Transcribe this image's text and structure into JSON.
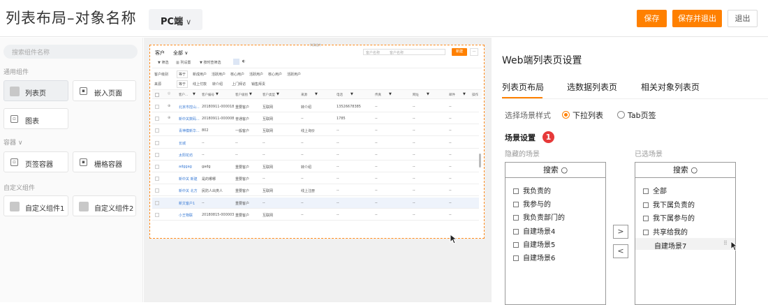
{
  "header": {
    "title": "列表布局–对象名称",
    "platform": "PC端",
    "save": "保存",
    "save_exit": "保存并退出",
    "exit": "退出"
  },
  "left": {
    "search_placeholder": "搜索组件名称",
    "sections": [
      {
        "title": "通用组件",
        "items": [
          "列表页",
          "嵌入页面",
          "图表"
        ]
      },
      {
        "title": "容器",
        "items": [
          "页签容器",
          "栅格容器"
        ]
      },
      {
        "title": "自定义组件",
        "items": [
          "自定义组件1",
          "自定义组件2"
        ]
      }
    ]
  },
  "preview": {
    "frame_label": "列表组件",
    "object": "客户",
    "scope": "全部",
    "toolbar": [
      "筛选",
      "列设置",
      "按时查筛选"
    ],
    "search_scope": "客户名称",
    "search_placeholder": "客户名称",
    "new_button": "新建",
    "quick_filters_1_label": "客户级别",
    "quick_filters_1_op": "等于",
    "quick_filters_1": [
      "新成用户",
      "活跃用户",
      "核心用户",
      "活跃用户",
      "核心用户",
      "活跃用户"
    ],
    "quick_filters_2_label": "来源",
    "quick_filters_2_op": "等于",
    "quick_filters_2": [
      "线上付款",
      "转介绍",
      "上门拜访",
      "销售拜责"
    ],
    "columns": [
      "客户...",
      "客户编号",
      "客户级别",
      "客户类型",
      "来源",
      "电话",
      "传真",
      "网址",
      "邮件",
      "操作"
    ],
    "rows": [
      [
        "北京市控山...",
        "20180911-000018",
        "重要客户",
        "互联网",
        "转介绍",
        "13526678385",
        "--",
        "--",
        "--"
      ],
      [
        "新中关数码...",
        "20180911-000008",
        "普通客户",
        "互联网",
        "--",
        "1785",
        "--",
        "--",
        "--"
      ],
      [
        "青神模新华...",
        "802",
        "一般客户",
        "互联网",
        "线上询价",
        "--",
        "--",
        "--",
        "--"
      ],
      [
        "长城",
        "--",
        "--",
        "--",
        "--",
        "--",
        "--",
        "--",
        "--"
      ],
      [
        "太阳花坊",
        "--",
        "--",
        "--",
        "--",
        "--",
        "--",
        "--",
        "--"
      ],
      [
        "adggag",
        "gadg",
        "重要客户",
        "互联网",
        "转介绍",
        "--",
        "--",
        "--",
        "--"
      ],
      [
        "新中关 新建",
        "是的哪哪",
        "重要客户",
        "--",
        "--",
        "--",
        "--",
        "--",
        "--"
      ],
      [
        "新中关 北方",
        "民防人出类人",
        "重要客户",
        "互联网",
        "线上注册",
        "--",
        "--",
        "--",
        "--"
      ],
      [
        "新文客户1",
        "--",
        "重要客户",
        "--",
        "--",
        "--",
        "--",
        "--",
        "--"
      ],
      [
        "小王物联",
        "20180815-000003",
        "重要客户",
        "互联网",
        "--",
        "--",
        "--",
        "--",
        "--"
      ]
    ]
  },
  "right": {
    "title": "Web端列表页设置",
    "tabs": [
      "列表页布局",
      "选数据列表页",
      "相关对象列表页"
    ],
    "scene_style_label": "选择场景样式",
    "option_dropdown": "下拉列表",
    "option_tab": "Tab页签",
    "scene_settings": "场景设置",
    "badge": "1",
    "hidden_title": "隐藏的场景",
    "selected_title": "已选场景",
    "search_label": "搜索",
    "hidden_items": [
      "我负责的",
      "我参与的",
      "我负责部门的",
      "自建场景4",
      "自建场景5",
      "自建场景6"
    ],
    "selected_items": [
      "全部",
      "我下属负责的",
      "我下属参与的",
      "共享给我的",
      "自建场景7"
    ],
    "move_right": ">",
    "move_left": "<"
  },
  "colors": {
    "accent": "#ff8000",
    "badge": "#e63939",
    "link": "#3a7bd5"
  }
}
